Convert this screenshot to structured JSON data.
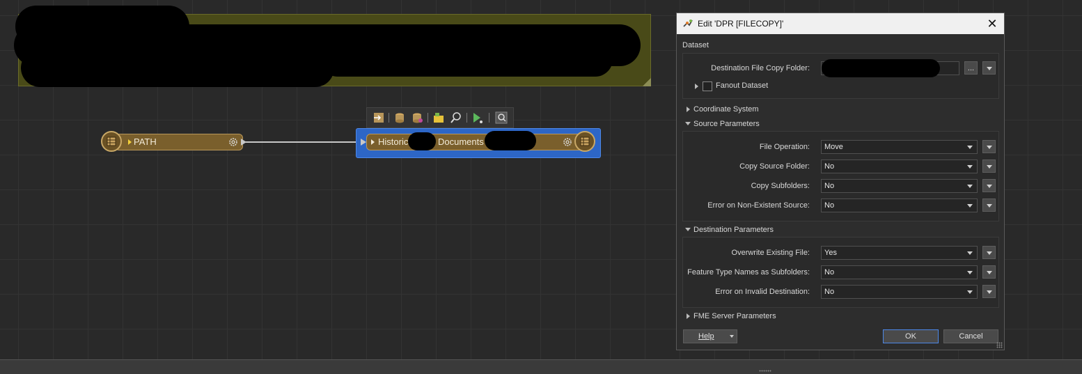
{
  "canvas": {
    "nodes": {
      "path_label": "PATH",
      "writer_label_part1": "Historica",
      "writer_label_part2": "Documents"
    },
    "toolbar_icons": [
      "insert-feature-icon",
      "reader-icon",
      "writer-icon",
      "bookmark-icon",
      "inspect-icon",
      "run-icon",
      "zoom-icon"
    ]
  },
  "dialog": {
    "title": "Edit 'DPR [FILECOPY]'",
    "sections": {
      "dataset": "Dataset",
      "coordinate_system": "Coordinate System",
      "source_parameters": "Source Parameters",
      "destination_parameters": "Destination Parameters",
      "fme_server_parameters": "FME Server Parameters"
    },
    "dataset": {
      "dest_folder_label": "Destination File Copy Folder:",
      "browse_label": "...",
      "fanout_label": "Fanout Dataset"
    },
    "source": {
      "file_operation_label": "File Operation:",
      "file_operation_value": "Move",
      "copy_source_folder_label": "Copy Source Folder:",
      "copy_source_folder_value": "No",
      "copy_subfolders_label": "Copy Subfolders:",
      "copy_subfolders_value": "No",
      "error_nonexistent_label": "Error on Non-Existent Source:",
      "error_nonexistent_value": "No"
    },
    "destination": {
      "overwrite_label": "Overwrite Existing File:",
      "overwrite_value": "Yes",
      "ft_names_label": "Feature Type Names as Subfolders:",
      "ft_names_value": "No",
      "error_invalid_label": "Error on Invalid Destination:",
      "error_invalid_value": "No"
    },
    "buttons": {
      "help": "Help",
      "ok": "OK",
      "cancel": "Cancel"
    }
  },
  "colors": {
    "accent": "#2d66c6",
    "node": "#7a5f2c",
    "note": "#494a18"
  }
}
